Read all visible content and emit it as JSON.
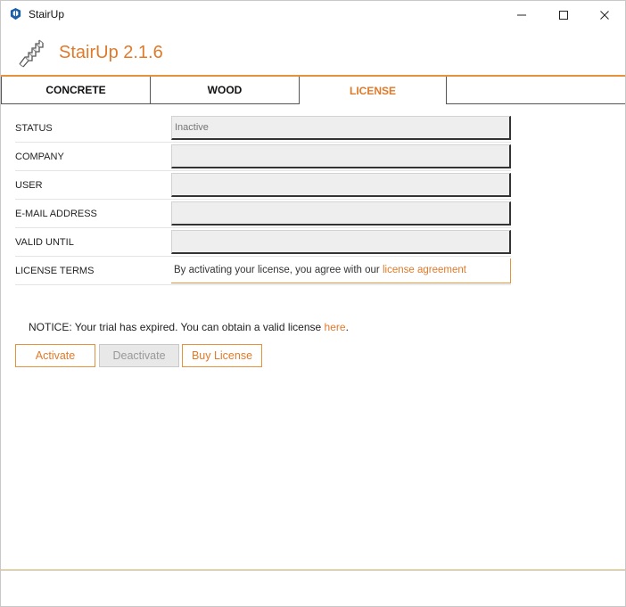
{
  "window": {
    "title": "StairUp"
  },
  "header": {
    "app_name": "StairUp 2.1.6"
  },
  "tabs": [
    {
      "label": "CONCRETE",
      "active": false
    },
    {
      "label": "WOOD",
      "active": false
    },
    {
      "label": "LICENSE",
      "active": true
    }
  ],
  "license": {
    "rows": [
      {
        "label": "STATUS",
        "value": "",
        "placeholder": "Inactive"
      },
      {
        "label": "COMPANY",
        "value": ""
      },
      {
        "label": "USER",
        "value": ""
      },
      {
        "label": "E-MAIL ADDRESS",
        "value": ""
      },
      {
        "label": "VALID UNTIL",
        "value": ""
      }
    ],
    "terms_label": "LICENSE TERMS",
    "terms_text": "By activating your license, you agree with our ",
    "terms_link": "license agreement"
  },
  "notice": {
    "text": "NOTICE: Your trial has expired. You can obtain a valid license ",
    "link": "here",
    "suffix": "."
  },
  "buttons": {
    "activate": "Activate",
    "deactivate": "Deactivate",
    "buy": "Buy License"
  },
  "colors": {
    "accent": "#e07a2a",
    "accent_line": "#e6913c",
    "footer_line": "#c9a45e",
    "field_bg": "#eeeeee"
  }
}
